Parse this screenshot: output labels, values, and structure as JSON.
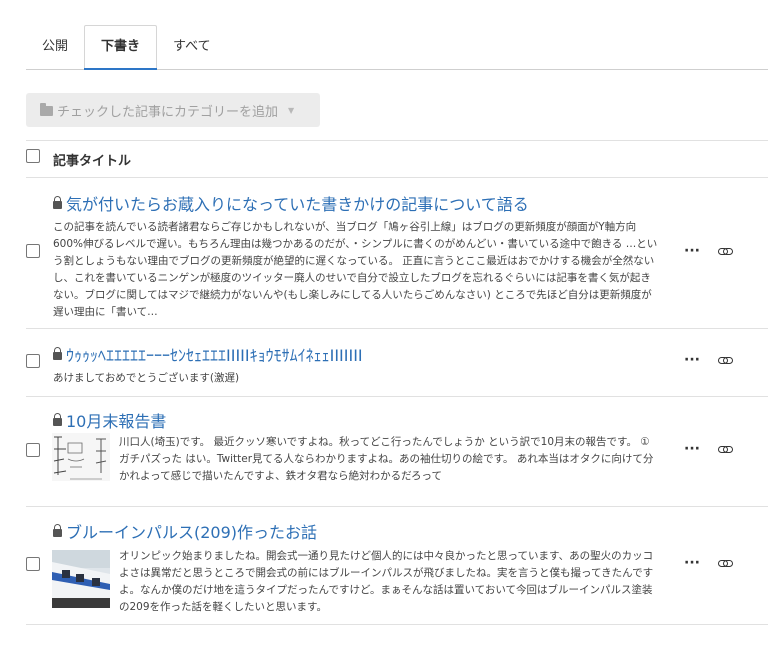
{
  "tabs": [
    {
      "label": "公開"
    },
    {
      "label": "下書き"
    },
    {
      "label": "すべて"
    }
  ],
  "category_button": {
    "label": "チェックした記事にカテゴリーを追加"
  },
  "list_header": {
    "title_label": "記事タイトル"
  },
  "articles": [
    {
      "title": "気が付いたらお蔵入りになっていた書きかけの記事について語る",
      "excerpt": "この記事を読んでいる読者諸君ならご存じかもしれないが、当ブログ「鳩ヶ谷引上線」はブログの更新頻度が顔面がY軸方向600%伸びるレベルで遅い。もちろん理由は幾つかあるのだが、・シンプルに書くのがめんどい・書いている途中で飽きる …という割としょうもない理由でブログの更新頻度が絶望的に遅くなっている。 正直に言うとここ最近はおでかけする機会が全然ないし、これを書いているニンゲンが極度のツイッター廃人のせいで自分で設立したブログを忘れるぐらいには記事を書く気が起きない。ブログに関してはマジで継続力がないんや(もし楽しみにしてる人いたらごめんなさい) ところで先ほど自分は更新頻度が遅い理由に「書いて…"
    },
    {
      "title": "ｳｩｩｯﾍｴｴｴｴｴｰｰｰｾﾝｾｪｴｴｴIIIIIｷｮｳﾓｻﾑｲﾈｪｪIIIIIII",
      "excerpt": "あけましておめでとうございます(激遅)"
    },
    {
      "title": "10月末報告書",
      "excerpt": "川口人(埼玉)です。 最近クッソ寒いですよね。秋ってどこ行ったんでしょうか という訳で10月末の報告です。 ①ガチパズった はい。Twitter見てる人ならわかりますよね。あの袖仕切りの絵です。 あれ本当はオタクに向けて分かれよって感じで描いたんですよ、鉄オタ君なら絶対わかるだろって"
    },
    {
      "title": "ブルーインパルス(209)作ったお話",
      "excerpt": "オリンピック始まりましたね。開会式一通り見たけど個人的には中々良かったと思っています、あの聖火のカッコよさは異常だと思うところで開会式の前にはブルーインパルスが飛びましたね。実を言うと僕も撮ってきたんですよ。なんか僕のだけ地を這うタイプだったんですけど。まぁそんな話は置いておいて今回はブルーインパルス塗装の209を作った話を軽くしたいと思います。"
    }
  ],
  "colors": {
    "title_link": "#2d6fb5",
    "tab_accent": "#2d76c7"
  },
  "icons": {
    "lock": "lock-icon",
    "more": "more-icon",
    "link": "link-icon",
    "folder": "folder-icon"
  }
}
